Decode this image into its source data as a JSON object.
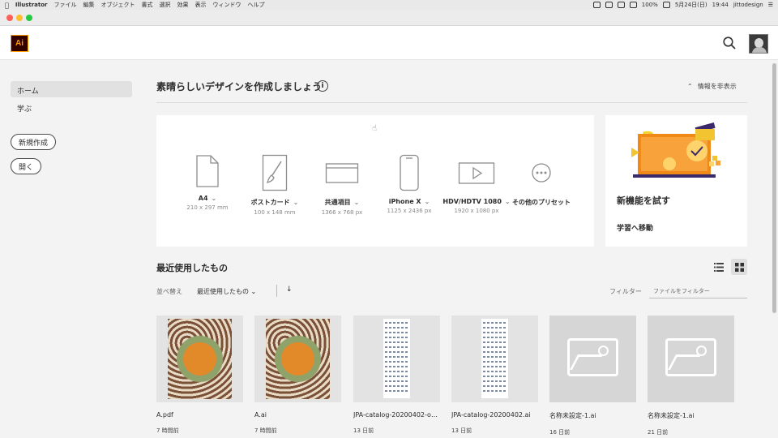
{
  "menubar": {
    "app_name": "Illustrator",
    "items": [
      "ファイル",
      "編集",
      "オブジェクト",
      "書式",
      "選択",
      "効果",
      "表示",
      "ウィンドウ",
      "ヘルプ"
    ],
    "battery": "100%",
    "date": "5月24日(日)",
    "time": "19:44",
    "user": "jittodesign"
  },
  "app": {
    "logo_text": "Ai",
    "brand_color": "#ff9a00"
  },
  "sidebar": {
    "items": [
      {
        "label": "ホーム",
        "active": true
      },
      {
        "label": "学ぶ",
        "active": false
      }
    ],
    "new_button": "新規作成",
    "open_button": "開く"
  },
  "headline": "素晴らしいデザインを作成しましょう",
  "hide_info_label": "情報を非表示",
  "presets": [
    {
      "name": "A4",
      "size": "210 x 297 mm",
      "icon": "document-icon"
    },
    {
      "name": "ポストカード",
      "size": "100 x 148 mm",
      "icon": "postcard-brush-icon"
    },
    {
      "name": "共通項目",
      "size": "1366 x 768 px",
      "icon": "browser-window-icon"
    },
    {
      "name": "iPhone X",
      "size": "1125 x 2436 px",
      "icon": "phone-icon"
    },
    {
      "name": "HDV/HDTV 1080",
      "size": "1920 x 1080 px",
      "icon": "video-play-icon"
    },
    {
      "name": "その他のプリセット",
      "size": "",
      "icon": "more-icon"
    }
  ],
  "new_features": {
    "title": "新機能を試す",
    "link": "学習へ移動"
  },
  "recent": {
    "title": "最近使用したもの",
    "sort_label": "並べ替え",
    "sort_value": "最近使用したもの",
    "sort_direction": "↓",
    "filter_label": "フィルター",
    "filter_placeholder": "ファイルをフィルター",
    "files": [
      {
        "name": "A.pdf",
        "time": "7 時間前",
        "thumb": "pattern"
      },
      {
        "name": "A.ai",
        "time": "7 時間前",
        "thumb": "pattern"
      },
      {
        "name": "JPA-catalog-20200402-outlii...",
        "time": "13 日前",
        "thumb": "catalog"
      },
      {
        "name": "JPA-catalog-20200402.ai",
        "time": "13 日前",
        "thumb": "catalog"
      },
      {
        "name": "名称未設定-1.ai",
        "time": "16 日前",
        "thumb": "placeholder"
      },
      {
        "name": "名称未設定-1.ai",
        "time": "21 日前",
        "thumb": "placeholder"
      }
    ]
  }
}
